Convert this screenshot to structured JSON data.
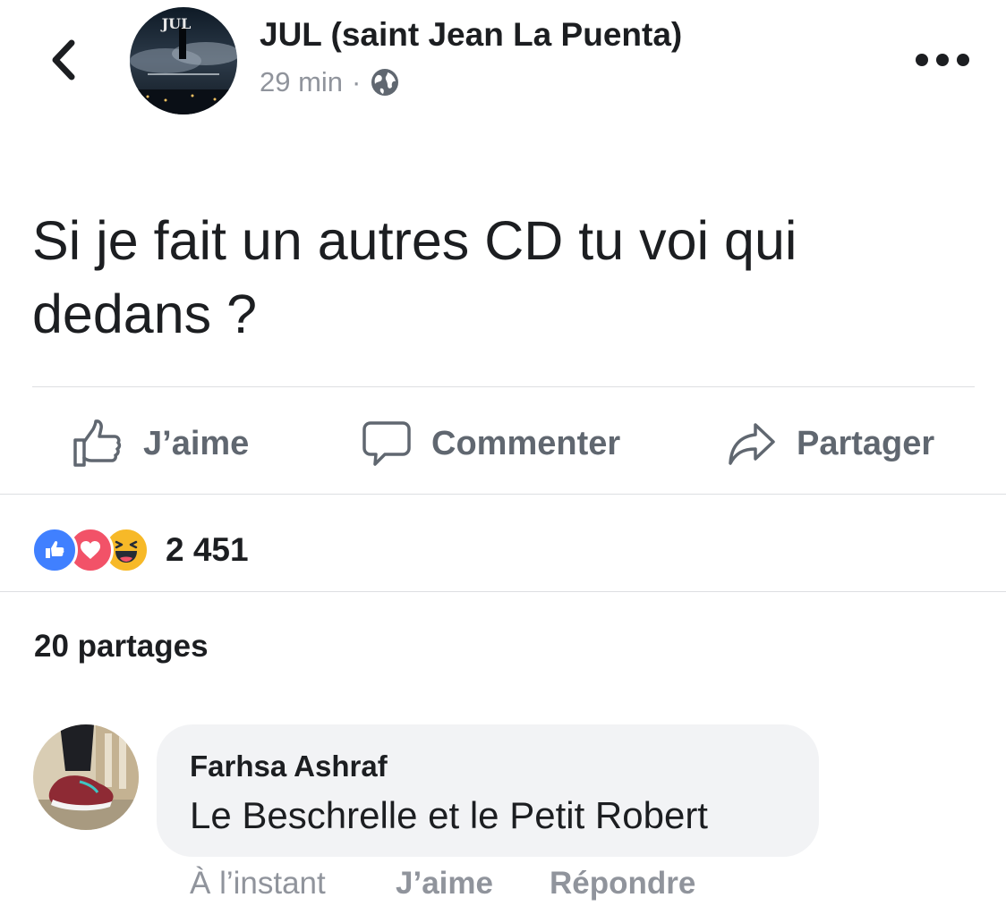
{
  "header": {
    "page_name": "JUL (saint Jean La Puenta)",
    "time": "29 min",
    "separator": "·",
    "avatar_text": "JUL",
    "privacy_icon": "globe-icon",
    "back_icon": "chevron-left-icon",
    "more_icon": "more-dots-icon"
  },
  "post": {
    "text": "Si je fait un autres CD tu voi qui dedans ?"
  },
  "actions": {
    "like": "J’aime",
    "comment": "Commenter",
    "share": "Partager"
  },
  "reactions": {
    "count": "2 451",
    "types": [
      "like-reaction-icon",
      "love-reaction-icon",
      "haha-reaction-icon"
    ],
    "colors": {
      "like": "#4080ff",
      "love": "#f25268",
      "haha": "#f7b928"
    }
  },
  "shares": "20 partages",
  "comment": {
    "author": "Farhsa Ashraf",
    "text": "Le Beschrelle et le Petit Robert",
    "time": "À l’instant",
    "like": "J’aime",
    "reply": "Répondre"
  }
}
